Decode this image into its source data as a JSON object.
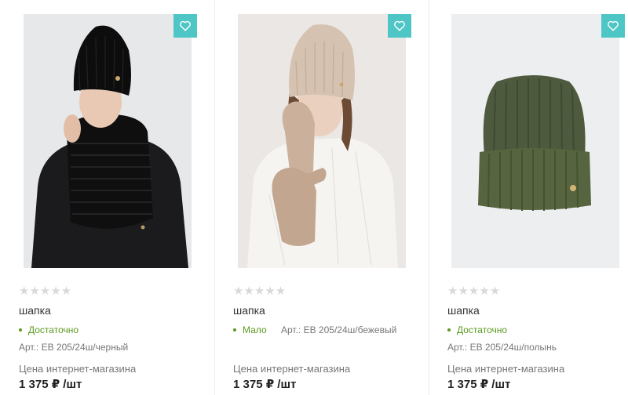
{
  "colors": {
    "accent": "#4fc6c6",
    "stock": "#5a9a1d",
    "star_empty": "#d9d9d9"
  },
  "products": [
    {
      "name": "шапка",
      "rating": 0,
      "stars": "★★★★★",
      "stock": "Достаточно",
      "article": "Арт.: EB 205/24ш/черный",
      "price_label": "Цена интернет-магазина",
      "price": "1 375 ₽ /шт",
      "favorite_icon": "heart-icon"
    },
    {
      "name": "шапка",
      "rating": 0,
      "stars": "★★★★★",
      "stock": "Мало",
      "article": "Арт.: EB 205/24ш/бежевый",
      "price_label": "Цена интернет-магазина",
      "price": "1 375 ₽ /шт",
      "favorite_icon": "heart-icon"
    },
    {
      "name": "шапка",
      "rating": 0,
      "stars": "★★★★★",
      "stock": "Достаточно",
      "article": "Арт.: EB 205/24ш/полынь",
      "price_label": "Цена интернет-магазина",
      "price": "1 375 ₽ /шт",
      "favorite_icon": "heart-icon"
    }
  ]
}
